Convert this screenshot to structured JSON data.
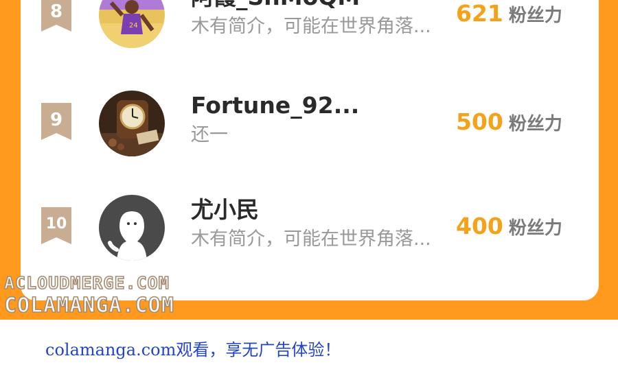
{
  "ranking": [
    {
      "rank": "8",
      "name": "阿霞_ShMoQM",
      "bio": "木有简介，可能在世界角落...",
      "fans_count": "621",
      "fans_unit": "粉丝力"
    },
    {
      "rank": "9",
      "name": "Fortune_92...",
      "bio": "还一",
      "fans_count": "500",
      "fans_unit": "粉丝力"
    },
    {
      "rank": "10",
      "name": "尤小民",
      "bio": "木有简介，可能在世界角落...",
      "fans_count": "400",
      "fans_unit": "粉丝力"
    }
  ],
  "watermark": {
    "line1": "ACLOUDMERGE.COM",
    "line2": "COLAMANGA.COM"
  },
  "footer": {
    "text": "colamanga.com观看，享无广告体验！"
  },
  "colors": {
    "frame": "#ff9a1f",
    "fans_count": "#f5a21b",
    "badge": "#c9ad93",
    "footer_link": "#2244cc"
  },
  "icons": {
    "avatar_8": "basketball-player-photo",
    "avatar_9": "antique-clock-photo",
    "avatar_10": "default-user-icon"
  }
}
